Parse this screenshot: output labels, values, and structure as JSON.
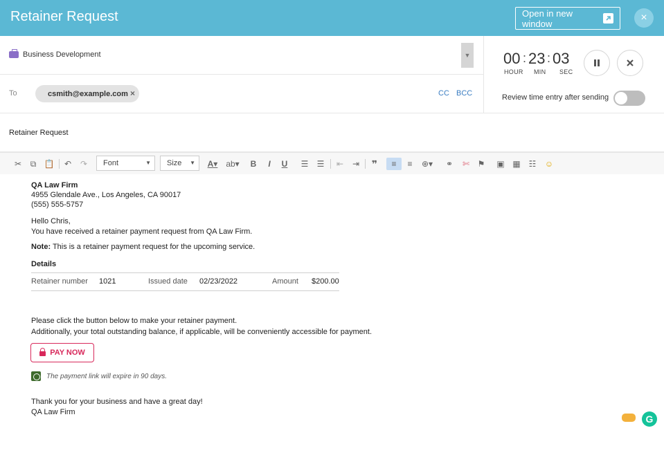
{
  "header": {
    "title": "Retainer Request",
    "open_new_window": "Open in new window",
    "close": "×"
  },
  "matter": {
    "value": "Business Development"
  },
  "recipients": {
    "to_label": "To",
    "chips": [
      "csmith@example.com"
    ],
    "cc": "CC",
    "bcc": "BCC"
  },
  "subject": "Retainer Request",
  "timer": {
    "hours": "00",
    "minutes": "23",
    "seconds": "03",
    "hour_label": "HOUR",
    "min_label": "MIN",
    "sec_label": "SEC",
    "review_label": "Review time entry after sending",
    "review_enabled": false
  },
  "toolbar": {
    "font_label": "Font",
    "size_label": "Size"
  },
  "email": {
    "firm_name": "QA Law Firm",
    "address": "4955 Glendale Ave., Los Angeles, CA 90017",
    "phone": "(555) 555-5757",
    "greeting": "Hello Chris,",
    "intro": "You have received a retainer payment request from QA Law Firm.",
    "note_label": "Note:",
    "note_text": " This is a retainer payment request for the upcoming service.",
    "details_heading": "Details",
    "retainer_number_label": "Retainer number",
    "retainer_number": "1021",
    "issued_date_label": "Issued date",
    "issued_date": "02/23/2022",
    "amount_label": "Amount",
    "amount": "$200.00",
    "instruction1": "Please click the button below to make your retainer payment.",
    "instruction2": "Additionally, your total outstanding balance, if applicable, will be conveniently accessible for payment.",
    "pay_button": "PAY NOW",
    "expire_note": "The payment link will expire in 90 days.",
    "closing": "Thank you for your business and have a great day!",
    "signature": "QA Law Firm"
  },
  "colors": {
    "header": "#5bb8d4",
    "pay_accent": "#d8285b",
    "link": "#3a7dc2"
  }
}
